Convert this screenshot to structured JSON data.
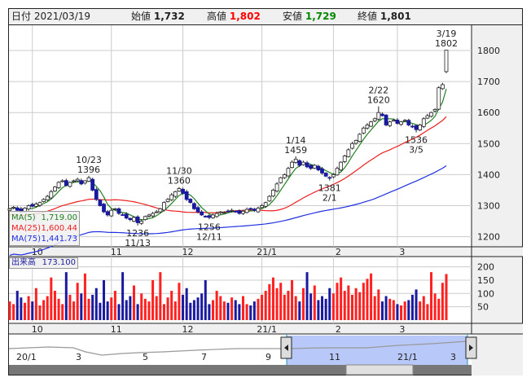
{
  "header": {
    "date_label": "日付",
    "date": "2021/03/19",
    "open_label": "始値",
    "open": "1,732",
    "high_label": "高値",
    "high": "1,802",
    "low_label": "安値",
    "low": "1,729",
    "close_label": "終値",
    "close": "1,801"
  },
  "colors": {
    "up_volume": "#ff2020",
    "down_volume": "#1a1aa0",
    "ma5": "#208020",
    "ma25": "#ee2020",
    "ma75": "#2030e0",
    "down_candle": "#1a1aa0"
  },
  "legend": {
    "ma5_label": "MA(5)",
    "ma5_value": "1,719.00",
    "ma25_label": "MA(25)",
    "ma25_value": "1,600.44",
    "ma75_label": "MA(75)",
    "ma75_value": "1,441.73"
  },
  "volume_legend": {
    "label": "出来高",
    "value": "173.100"
  },
  "chart_data": {
    "type": "candlestick",
    "price_axis": {
      "ylim": [
        1180,
        1850
      ],
      "ticks": [
        1200,
        1300,
        1400,
        1500,
        1600,
        1700,
        1800
      ]
    },
    "volume_axis": {
      "ylim": [
        0,
        215
      ],
      "ticks": [
        50,
        100,
        150,
        200
      ]
    },
    "month_ticks": [
      {
        "i": 6,
        "label": "10"
      },
      {
        "i": 27,
        "label": "11"
      },
      {
        "i": 46,
        "label": "12"
      },
      {
        "i": 67,
        "label": "21/1"
      },
      {
        "i": 86,
        "label": "2"
      },
      {
        "i": 103,
        "label": "3"
      }
    ],
    "closes": [
      1290,
      1295,
      1285,
      1280,
      1292,
      1300,
      1298,
      1305,
      1310,
      1320,
      1330,
      1345,
      1360,
      1375,
      1380,
      1365,
      1375,
      1380,
      1385,
      1370,
      1380,
      1390,
      1350,
      1320,
      1300,
      1280,
      1270,
      1285,
      1290,
      1275,
      1270,
      1260,
      1255,
      1262,
      1245,
      1250,
      1265,
      1270,
      1275,
      1280,
      1290,
      1310,
      1320,
      1335,
      1345,
      1355,
      1340,
      1320,
      1310,
      1290,
      1280,
      1270,
      1265,
      1262,
      1270,
      1275,
      1280,
      1278,
      1282,
      1285,
      1280,
      1275,
      1282,
      1288,
      1290,
      1285,
      1292,
      1300,
      1310,
      1330,
      1350,
      1370,
      1390,
      1400,
      1420,
      1440,
      1450,
      1430,
      1440,
      1425,
      1420,
      1430,
      1415,
      1405,
      1395,
      1390,
      1400,
      1420,
      1440,
      1460,
      1480,
      1500,
      1510,
      1530,
      1550,
      1560,
      1570,
      1580,
      1600,
      1590,
      1560,
      1570,
      1575,
      1565,
      1570,
      1575,
      1560,
      1555,
      1545,
      1560,
      1580,
      1590,
      1600,
      1610,
      1680,
      1690,
      1801
    ],
    "last_open": 1732,
    "volumes": [
      70,
      60,
      110,
      85,
      65,
      90,
      70,
      120,
      55,
      75,
      90,
      160,
      110,
      80,
      60,
      180,
      95,
      70,
      140,
      100,
      175,
      80,
      95,
      120,
      65,
      150,
      70,
      85,
      110,
      60,
      180,
      75,
      90,
      130,
      60,
      100,
      80,
      70,
      150,
      90,
      180,
      60,
      85,
      110,
      70,
      140,
      95,
      120,
      65,
      75,
      85,
      100,
      150,
      60,
      75,
      110,
      90,
      70,
      65,
      85,
      75,
      60,
      90,
      60,
      55,
      70,
      80,
      95,
      110,
      135,
      160,
      120,
      140,
      95,
      110,
      150,
      90,
      70,
      120,
      180,
      100,
      130,
      75,
      90,
      80,
      120,
      100,
      140,
      160,
      110,
      130,
      95,
      120,
      105,
      140,
      155,
      175,
      90,
      115,
      70,
      90,
      80,
      75,
      60,
      55,
      70,
      75,
      95,
      115,
      70,
      90,
      60,
      180,
      100,
      80,
      140,
      173
    ],
    "annotations": [
      {
        "i": 21,
        "date": "10/23",
        "value": "1396",
        "pos": "above"
      },
      {
        "i": 34,
        "date": "11/13",
        "value": "1236",
        "pos": "below"
      },
      {
        "i": 45,
        "date": "11/30",
        "value": "1360",
        "pos": "above"
      },
      {
        "i": 53,
        "date": "12/11",
        "value": "1256",
        "pos": "below"
      },
      {
        "i": 76,
        "date": "1/14",
        "value": "1459",
        "pos": "above"
      },
      {
        "i": 85,
        "date": "2/1",
        "value": "1381",
        "pos": "below"
      },
      {
        "i": 98,
        "date": "2/22",
        "value": "1620",
        "pos": "above"
      },
      {
        "i": 108,
        "date": "3/5",
        "value": "1536",
        "pos": "below"
      },
      {
        "i": 116,
        "date": "3/19",
        "value": "1802",
        "pos": "above"
      }
    ]
  },
  "navigator": {
    "labels": [
      "20/1",
      "3",
      "5",
      "7",
      "9",
      "11",
      "21/1",
      "3"
    ]
  }
}
